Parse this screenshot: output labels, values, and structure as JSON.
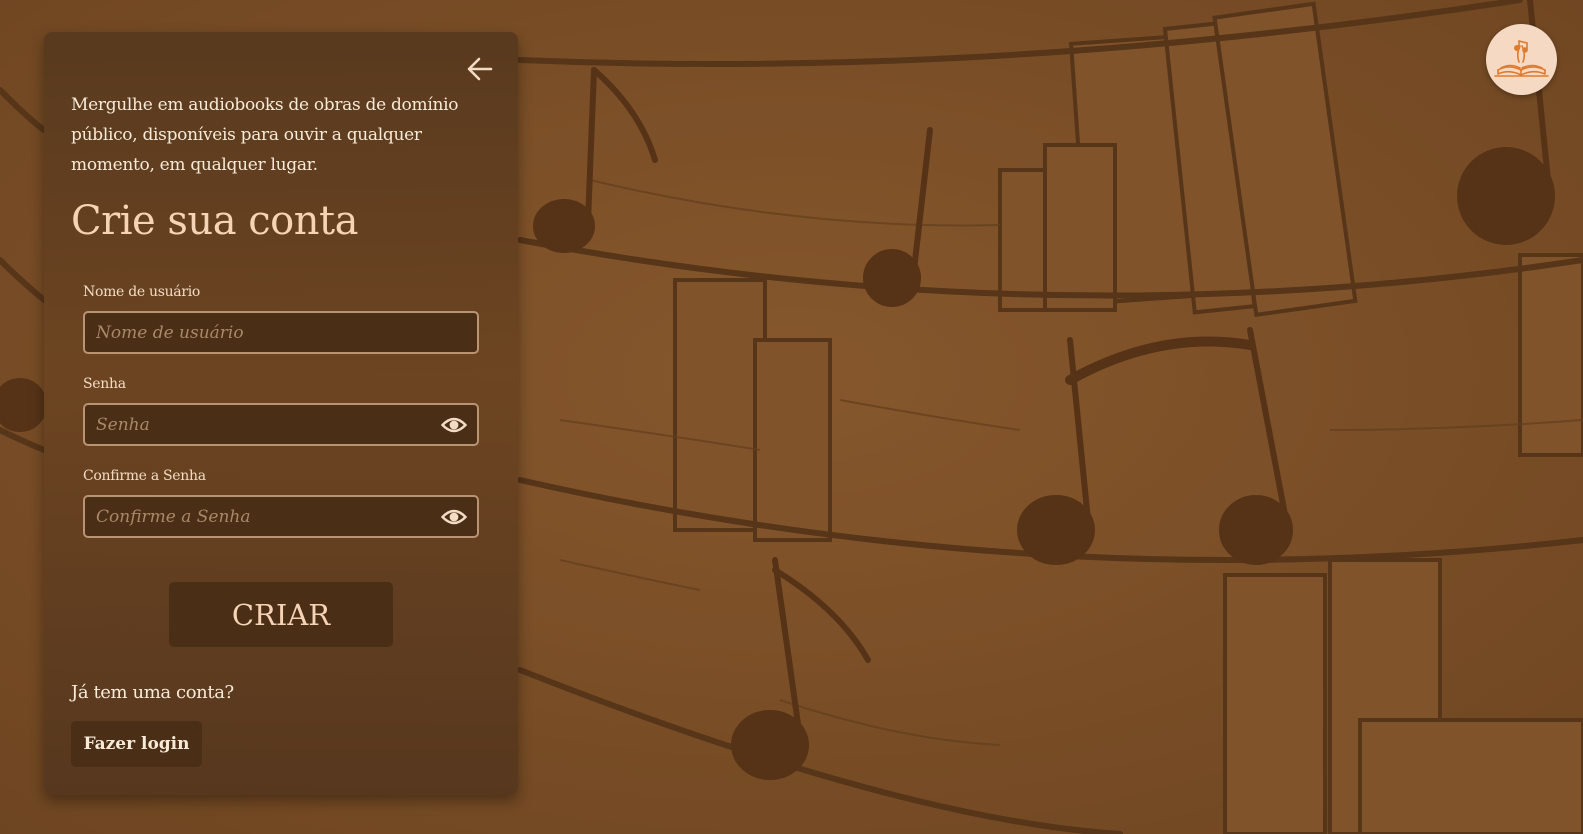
{
  "intro_text": "Mergulhe em audiobooks de obras de domínio público, disponíveis para ouvir a qualquer momento, em qualquer lugar.",
  "form": {
    "title": "Crie sua conta",
    "username": {
      "label": "Nome de usuário",
      "value": "",
      "placeholder": "Nome de usuário"
    },
    "password": {
      "label": "Senha",
      "value": "",
      "placeholder": "Senha",
      "toggle_icon": "eye-icon"
    },
    "confirm_password": {
      "label": "Confirme a Senha",
      "value": "",
      "placeholder": "Confirme a Senha",
      "toggle_icon": "eye-icon"
    },
    "submit_label": "CRIAR"
  },
  "login_prompt": {
    "text": "Já tem uma conta?",
    "button_label": "Fazer login"
  },
  "icons": {
    "back": "arrow-left-icon",
    "logo": "open-book-music-logo"
  },
  "colors": {
    "background": "#7a4e26",
    "panel": "#5e3c1e",
    "input_bg": "#4a2e16",
    "button_bg": "#4a2e16",
    "accent_text": "#f6d3b4",
    "body_text": "#f7ead8",
    "logo_bg": "#f5d9c2",
    "logo_stroke": "#e07a2c"
  }
}
